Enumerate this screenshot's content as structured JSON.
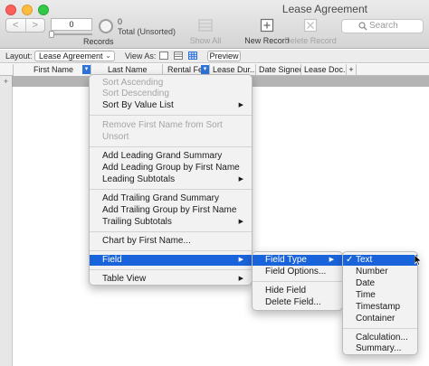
{
  "window": {
    "title": "Lease Agreement"
  },
  "toolbar": {
    "nav_back": "<",
    "nav_forward": ">",
    "record_number": "0",
    "records_label": "Records",
    "found_count": "0",
    "found_text": "Total (Unsorted)",
    "show_all": "Show All",
    "new_record": "New Record",
    "delete_record": "Delete Record",
    "search_placeholder": "Search"
  },
  "layout_bar": {
    "layout_label": "Layout:",
    "layout_value": "Lease Agreement",
    "view_as_label": "View As:",
    "preview": "Preview"
  },
  "table": {
    "columns": [
      "First Name",
      "Last Name",
      "Rental Fe",
      "Lease Dur...",
      "Date Signed",
      "Lease Doc..."
    ],
    "add_column": "+",
    "add_row": "+"
  },
  "context_menu": {
    "sort_ascending": "Sort Ascending",
    "sort_descending": "Sort Descending",
    "sort_by_value_list": "Sort By Value List",
    "remove_sort": "Remove First Name from Sort",
    "unsort": "Unsort",
    "add_leading_grand": "Add Leading Grand Summary",
    "add_leading_group": "Add Leading Group by First Name",
    "leading_subtotals": "Leading Subtotals",
    "add_trailing_grand": "Add Trailing Grand Summary",
    "add_trailing_group": "Add Trailing Group by First Name",
    "trailing_subtotals": "Trailing Subtotals",
    "chart_by": "Chart by First Name...",
    "field": "Field",
    "table_view": "Table View"
  },
  "field_submenu": {
    "field_type": "Field Type",
    "field_options": "Field Options...",
    "hide_field": "Hide Field",
    "delete_field": "Delete Field..."
  },
  "field_type_submenu": {
    "checkmark": "✓",
    "items": [
      "Text",
      "Number",
      "Date",
      "Time",
      "Timestamp",
      "Container"
    ],
    "calculation": "Calculation...",
    "summary": "Summary..."
  },
  "colors": {
    "highlight": "#1a64db",
    "menu_bg": "#f2f2f2"
  }
}
